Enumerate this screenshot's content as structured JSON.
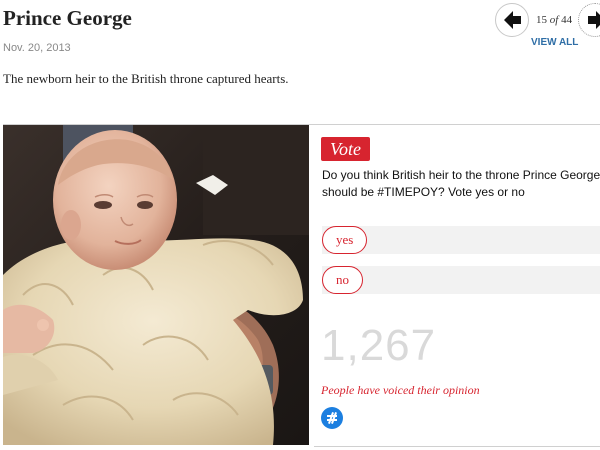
{
  "article": {
    "title": "Prince George",
    "date": "Nov. 20, 2013",
    "dek": "The newborn heir to the British throne captured hearts."
  },
  "gallery_nav": {
    "current": "15",
    "of_label": "of",
    "total": "44",
    "view_all_label": "VIEW ALL",
    "prev_icon": "arrow-left-icon",
    "next_icon": "arrow-right-icon"
  },
  "photo": {
    "description_icon": "baby-photo"
  },
  "poll": {
    "badge": "Vote",
    "question": "Do you think British heir to the throne Prince George should be #TIMEPOY? Vote yes or no",
    "options": [
      {
        "label": "yes"
      },
      {
        "label": "no"
      }
    ],
    "vote_count": "1,267",
    "status_text": "People have voiced their opinion",
    "logo_icon": "poll-logo-icon"
  },
  "colors": {
    "accent": "#d7242f",
    "link": "#2f6ea6",
    "count": "#d9d9d9",
    "logo": "#1c7fe0"
  }
}
